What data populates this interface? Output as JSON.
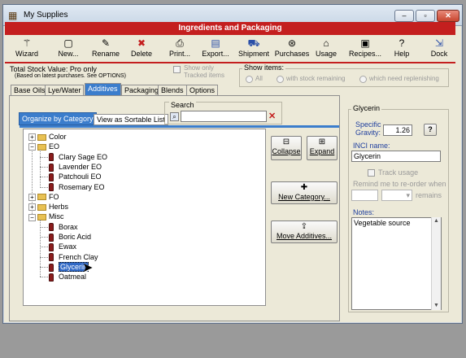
{
  "window": {
    "title": "My Supplies",
    "min": "–",
    "max": "▫",
    "close": "✕"
  },
  "header": {
    "title": "Ingredients and Packaging"
  },
  "toolbar": [
    {
      "label": "Wizard",
      "icon": "wand-icon",
      "glyph": "⚚"
    },
    {
      "label": "New...",
      "icon": "new-page-icon",
      "glyph": "▢"
    },
    {
      "label": "Rename",
      "icon": "rename-icon",
      "glyph": "✎"
    },
    {
      "label": "Delete",
      "icon": "delete-icon",
      "glyph": "✖"
    },
    {
      "label": "Print...",
      "icon": "printer-icon",
      "glyph": "⎙"
    },
    {
      "label": "Export...",
      "icon": "export-icon",
      "glyph": "▤"
    },
    {
      "label": "Shipment",
      "icon": "truck-icon",
      "glyph": "⛟"
    },
    {
      "label": "Purchases",
      "icon": "purchases-icon",
      "glyph": "⊛"
    },
    {
      "label": "Usage",
      "icon": "usage-icon",
      "glyph": "⌂"
    },
    {
      "label": "Recipes...",
      "icon": "recipes-icon",
      "glyph": "▣"
    },
    {
      "label": "Help",
      "icon": "help-icon",
      "glyph": "?"
    },
    {
      "label": "Dock",
      "icon": "dock-icon",
      "glyph": "⇲"
    }
  ],
  "stock": {
    "label": "Total Stock Value:  Pro only",
    "note": "(Based on latest purchases. See OPTIONS)"
  },
  "show_only": {
    "line1": "Show only",
    "line2": "Tracked items"
  },
  "show_items": {
    "title": "Show items:",
    "options": [
      "All",
      "with stock remaining",
      "which need replenishing"
    ]
  },
  "tabs": [
    "Base Oils",
    "Lye/Water",
    "Additives",
    "Packaging",
    "Blends",
    "Options"
  ],
  "subtabs": {
    "by_category": "Organize by Category",
    "sortable": "View as Sortable List"
  },
  "search": {
    "title": "Search",
    "value": ""
  },
  "tree": [
    {
      "label": "Color",
      "type": "folder",
      "expander": "+"
    },
    {
      "label": "EO",
      "type": "folder",
      "expander": "−"
    },
    {
      "label": "Clary Sage EO",
      "type": "item"
    },
    {
      "label": "Lavender EO",
      "type": "item"
    },
    {
      "label": "Patchouli EO",
      "type": "item"
    },
    {
      "label": "Rosemary EO",
      "type": "item"
    },
    {
      "label": "FO",
      "type": "folder",
      "expander": "+"
    },
    {
      "label": "Herbs",
      "type": "folder",
      "expander": "+"
    },
    {
      "label": "Misc",
      "type": "folder",
      "expander": "−"
    },
    {
      "label": "Borax",
      "type": "item"
    },
    {
      "label": "Boric Acid",
      "type": "item"
    },
    {
      "label": "Ewax",
      "type": "item"
    },
    {
      "label": "French Clay",
      "type": "item"
    },
    {
      "label": "Glycerin",
      "type": "item",
      "selected": true
    },
    {
      "label": "Oatmeal",
      "type": "item"
    }
  ],
  "buttons": {
    "collapse": "Collapse",
    "expand": "Expand",
    "new_category": "New Category...",
    "move_additives": "Move Additives..."
  },
  "detail": {
    "title": "Glycerin",
    "sg_label1": "Specific",
    "sg_label2": "Gravity:",
    "sg_value": "1.26",
    "sg_help": "?",
    "inci_label": "INCI name:",
    "inci_value": "Glycerin",
    "track_usage": "Track usage",
    "remind_label": "Remind me to re-order when",
    "remains": "remains",
    "notes_label": "Notes:",
    "notes_value": "Vegetable source"
  }
}
